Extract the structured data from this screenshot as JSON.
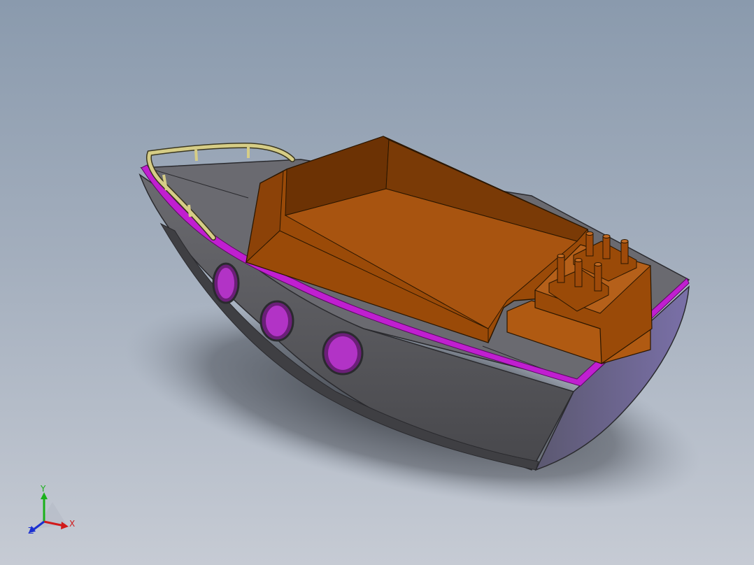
{
  "viewport": {
    "background_top": "#8a9aad",
    "background_bottom": "#c6cbd4"
  },
  "model": {
    "hull_color": "#58585c",
    "deck_color": "#6a6a70",
    "cabin_color": "#9a4a08",
    "cabin_dark_color": "#6c3204",
    "trim_color": "#c01fd0",
    "railing_color": "#d6cd86"
  },
  "triad": {
    "x_label": "X",
    "y_label": "Y",
    "z_label": "Z",
    "x_color": "#d11a1a",
    "y_color": "#1ab11a",
    "z_color": "#1a2fd1"
  }
}
